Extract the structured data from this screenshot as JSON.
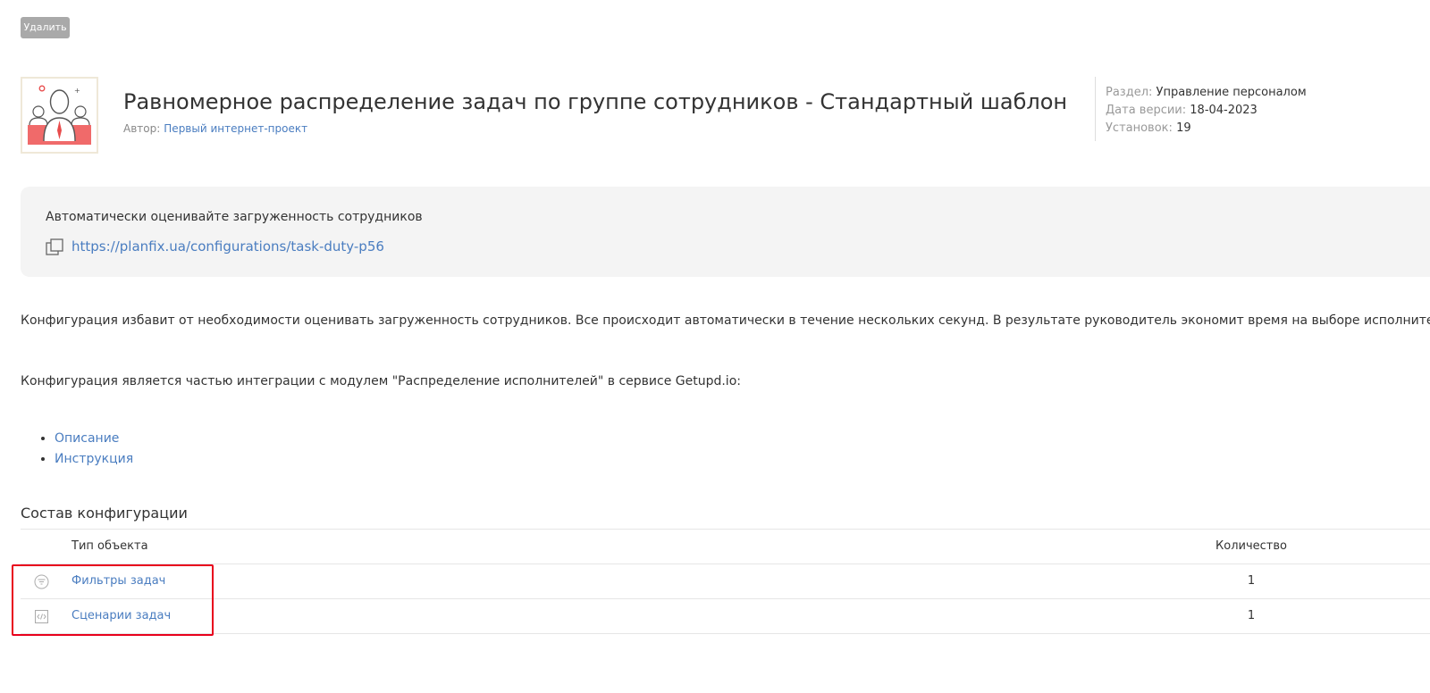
{
  "toolbar": {
    "delete_label": "Удалить"
  },
  "header": {
    "title": "Равномерное распределение задач по группе сотрудников - Стандартный шаблон",
    "author_label": "Автор:",
    "author_name": "Первый интернет-проект",
    "logo_icon": "team-people-icon"
  },
  "meta": {
    "section_label": "Раздел:",
    "section_value": "Управление персоналом",
    "version_label": "Дата версии:",
    "version_value": "18-04-2023",
    "installs_label": "Установок:",
    "installs_value": "19"
  },
  "panel": {
    "tagline": "Автоматически оценивайте загруженность сотрудников",
    "copy_icon": "copy-icon",
    "url": "https://planfix.ua/configurations/task-duty-p56"
  },
  "description": {
    "paragraph1": "Конфигурация избавит от необходимости оценивать загруженность сотрудников. Все происходит автоматически в течение нескольких секунд. В результате руководитель экономит время на выборе исполнителя.",
    "paragraph2": "Конфигурация является частью интеграции с модулем \"Распределение исполнителей\" в сервисе Getupd.io:",
    "links": [
      {
        "label": "Описание"
      },
      {
        "label": "Инструкция"
      }
    ]
  },
  "composition": {
    "title": "Состав конфигурации",
    "columns": {
      "type": "Тип объекта",
      "count": "Количество"
    },
    "rows": [
      {
        "icon": "filter-icon",
        "type": "Фильтры задач",
        "count": "1"
      },
      {
        "icon": "code-script-icon",
        "type": "Сценарии задач",
        "count": "1"
      }
    ]
  },
  "colors": {
    "link": "#4a7dc0",
    "highlight": "#e8001c",
    "panel_bg": "#f4f4f4",
    "button_bg": "#a9a9a9"
  }
}
